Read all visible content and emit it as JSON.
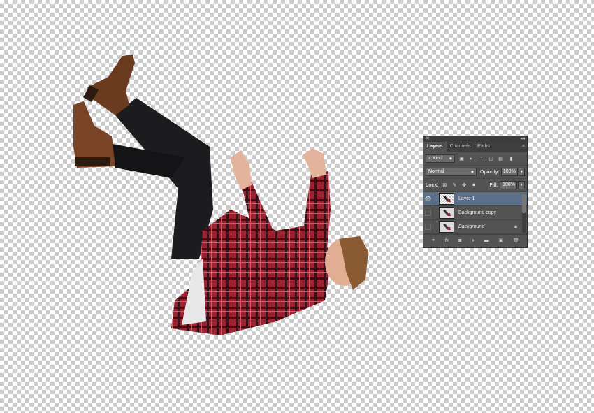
{
  "canvas": {
    "checker_color": "#cccccc"
  },
  "panel": {
    "tabs": [
      {
        "label": "Layers",
        "active": true
      },
      {
        "label": "Channels",
        "active": false
      },
      {
        "label": "Paths",
        "active": false
      }
    ],
    "filter": {
      "label": "Kind"
    },
    "blend_mode": "Normal",
    "opacity_label": "Opacity:",
    "opacity_value": "100%",
    "lock_label": "Lock:",
    "fill_label": "Fill:",
    "fill_value": "100%",
    "layers": [
      {
        "name": "Layer 1",
        "visible": true,
        "selected": true
      },
      {
        "name": "Background copy",
        "visible": false,
        "selected": false
      },
      {
        "name": "Background",
        "visible": false,
        "selected": false,
        "locked": true
      }
    ]
  }
}
